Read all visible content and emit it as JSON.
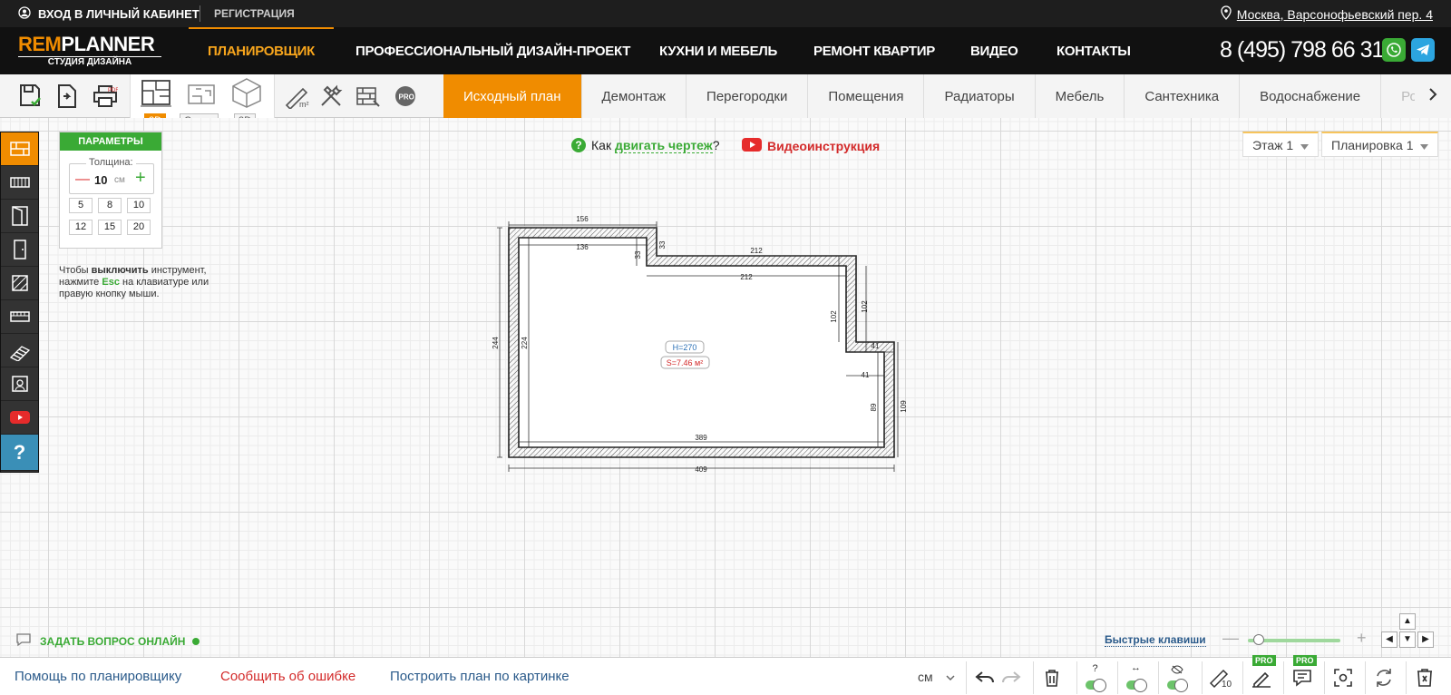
{
  "topbar": {
    "login_label": "ВХОД В ЛИЧНЫЙ КАБИНЕТ",
    "register_label": "РЕГИСТРАЦИЯ",
    "address": "Москва, Варсонофьевский пер. 4"
  },
  "brand": {
    "rem": "REM",
    "planner": "PLANNER",
    "tagline": "СТУДИЯ ДИЗАЙНА",
    "accent": "#f08c00"
  },
  "nav": {
    "items": [
      "ПЛАНИРОВЩИК",
      "ПРОФЕССИОНАЛЬНЫЙ ДИЗАЙН-ПРОЕКТ",
      "КУХНИ И МЕБЕЛЬ",
      "РЕМОНТ КВАРТИР",
      "ВИДЕО",
      "КОНТАКТЫ"
    ],
    "phone": "8 (495) 798 66 31"
  },
  "views": {
    "label_2d": "2D",
    "label_walls": "Стены",
    "label_3d": "3D",
    "pro_badge": "PRO"
  },
  "tabs": [
    "Исходный план",
    "Демонтаж",
    "Перегородки",
    "Помещения",
    "Радиаторы",
    "Мебель",
    "Сантехника",
    "Водоснабжение",
    "Ро"
  ],
  "params": {
    "title": "ПАРАМЕТРЫ",
    "thickness_label": "Толщина:",
    "thickness_value": "10",
    "unit": "см",
    "presets": [
      "5",
      "8",
      "10",
      "12",
      "15",
      "20"
    ]
  },
  "hint": {
    "part1": "Чтобы ",
    "bold": "выключить",
    "part2": " инструмент, нажмите ",
    "esc": "Esc",
    "part3": " на клавиатуре или правую кнопку мыши."
  },
  "help": {
    "how_prefix": "Как ",
    "how_link": "двигать чертеж",
    "how_suffix": "?",
    "video_label": "Видеоинструкция"
  },
  "selectors": {
    "floor": "Этаж 1",
    "layout": "Планировка 1"
  },
  "plan": {
    "dims": [
      "156",
      "136",
      "33",
      "33",
      "212",
      "212",
      "102",
      "102",
      "41",
      "41",
      "89",
      "109",
      "244",
      "224",
      "389",
      "409"
    ],
    "height_label": "H=270",
    "area_label": "S=7.46 м²"
  },
  "chat": {
    "ask_label": "ЗАДАТЬ ВОПРОС ОНЛАЙН"
  },
  "hotkeys_label": "Быстрые клавиши",
  "bottom": {
    "help_link": "Помощь по планировщику",
    "report_link": "Сообщить об ошибке",
    "build_link": "Построить план по картинке",
    "unit": "см",
    "pro_badge": "PRO"
  },
  "colors": {
    "green": "#3aaa35",
    "red": "#d32a2a",
    "orange": "#f08c00"
  }
}
